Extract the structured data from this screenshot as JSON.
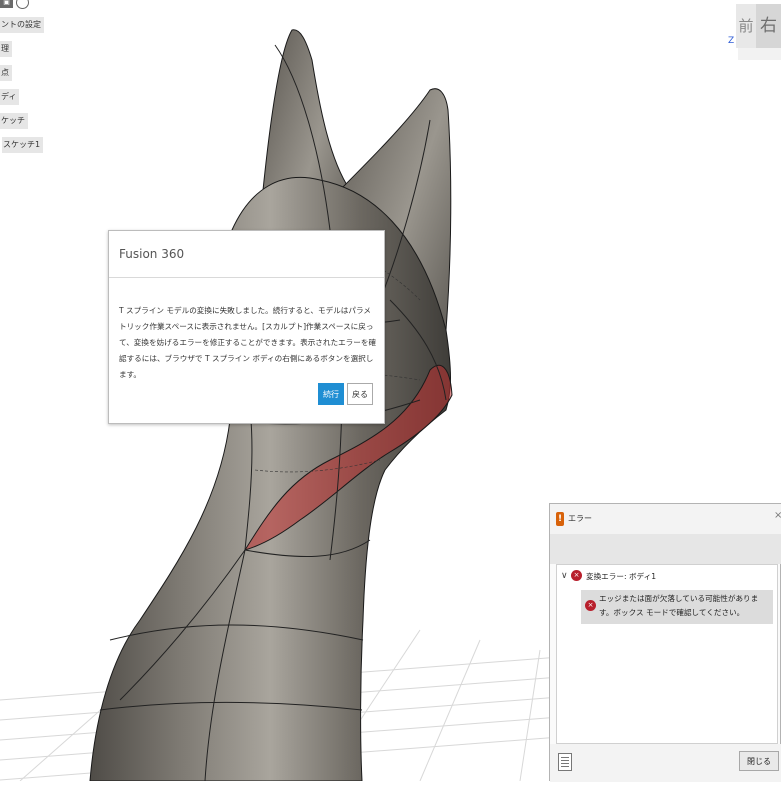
{
  "browser": {
    "items": [
      {
        "label": "ントの設定"
      },
      {
        "label": "理"
      },
      {
        "label": "点"
      },
      {
        "label": "ディ"
      },
      {
        "label": "ケッチ"
      },
      {
        "label": "スケッチ1"
      }
    ]
  },
  "viewcube": {
    "front_label": "前",
    "right_label": "右",
    "axis_label": "Z"
  },
  "dialog": {
    "title": "Fusion 360",
    "message": "T スプライン モデルの変換に失敗しました。続行すると、モデルはパラメトリック作業スペースに表示されません。[スカルプト]作業スペースに戻って、変換を妨げるエラーを修正することができます。表示されたエラーを確認するには、ブラウザで T スプライン ボディの右側にあるボタンを選択します。",
    "continue_label": "続行",
    "back_label": "戻る"
  },
  "error_panel": {
    "title": "エラー",
    "close_x": "×",
    "group_label": "変換エラー: ボディ1",
    "item_text": "エッジまたは面が欠落している可能性があります。ボックス モードで確認してください。",
    "close_label": "閉じる"
  },
  "colors": {
    "model_surface": "#6e6a63",
    "error_highlight": "#c0302f",
    "accent": "#1f8ed3",
    "error_icon": "#b81f2c"
  }
}
